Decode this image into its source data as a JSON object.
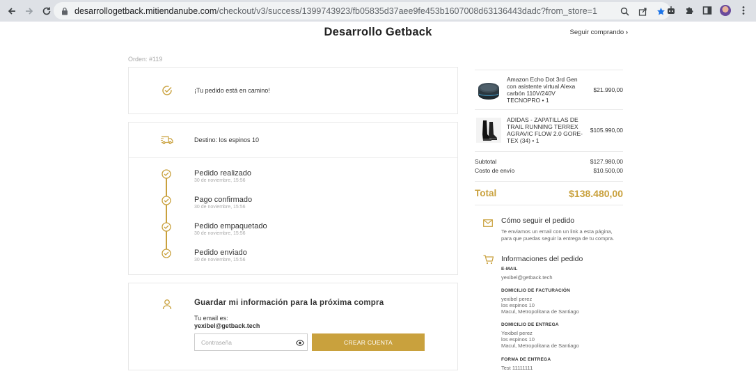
{
  "browser": {
    "url_host": "desarrollogetback.mitiendanube.com",
    "url_path": "/checkout/v3/success/1399743923/fb05835d37aee9fe453b1607008d63136443dadc?from_store=1"
  },
  "header": {
    "store_name": "Desarrollo Getback",
    "continue_link": "Seguir comprando"
  },
  "order": {
    "number_label": "Orden: #119"
  },
  "status": {
    "message": "¡Tu pedido está en camino!"
  },
  "shipping": {
    "destination": "Destino: los espinos 10",
    "steps": [
      {
        "title": "Pedido realizado",
        "date": "30 de noviembre, 15:56"
      },
      {
        "title": "Pago confirmado",
        "date": "30 de noviembre, 15:56"
      },
      {
        "title": "Pedido empaquetado",
        "date": "30 de noviembre, 15:56"
      },
      {
        "title": "Pedido enviado",
        "date": "30 de noviembre, 15:56"
      }
    ]
  },
  "save_info": {
    "title": "Guardar mi información para la próxima compra",
    "email_label": "Tu email es:",
    "email": "yexibel@getback.tech",
    "password_placeholder": "Contraseña",
    "create_button": "CREAR CUENTA"
  },
  "cart": {
    "products": [
      {
        "name": "Amazon Echo Dot 3rd Gen con asistente virtual Alexa carbón 110V/240V TECNOPRO • 1",
        "price": "$21.990,00"
      },
      {
        "name": "ADIDAS - ZAPATILLAS DE TRAIL RUNNING TERREX AGRAVIC FLOW 2.0 GORE-TEX (34) • 1",
        "price": "$105.990,00"
      }
    ],
    "subtotal_label": "Subtotal",
    "subtotal": "$127.980,00",
    "shipping_label": "Costo de envío",
    "shipping_cost": "$10.500,00",
    "total_label": "Total",
    "total": "$138.480,00"
  },
  "follow": {
    "title": "Cómo seguir el pedido",
    "body": "Te enviamos un email con un link a esta página, para que puedas seguir la entrega de tu compra."
  },
  "order_info": {
    "title": "Informaciones del pedido",
    "email_label": "E-MAIL",
    "email": "yexibel@getback.tech",
    "billing_label": "DOMICILIO DE FACTURACIÓN",
    "billing_lines": [
      "yexibel perez",
      "los espinos 10",
      "Macul, Metropolitana de Santiago"
    ],
    "delivery_label": "DOMICILIO DE ENTREGA",
    "delivery_lines": [
      "Yexibel perez",
      "los espinos 10",
      "Macul, Metropolitana de Santiago"
    ],
    "method_label": "FORMA DE ENTREGA",
    "method": "Test 11111111"
  },
  "colors": {
    "accent": "#c9a13d"
  }
}
